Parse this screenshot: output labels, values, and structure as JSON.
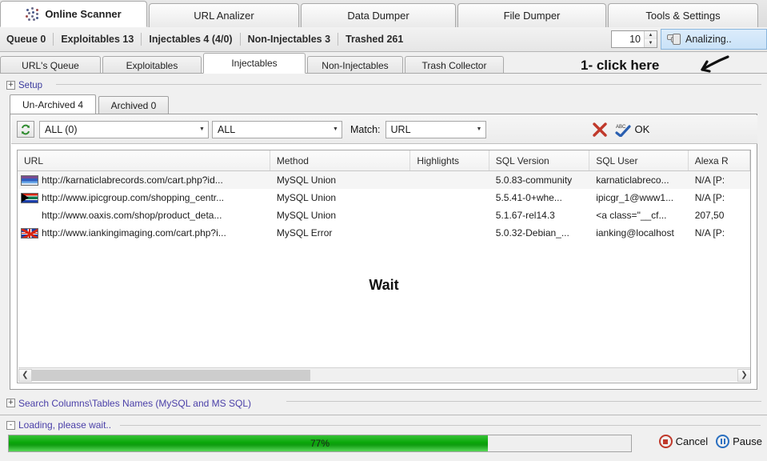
{
  "main_tabs": [
    {
      "label": "Online Scanner",
      "icon": "network-dots-icon",
      "selected": true
    },
    {
      "label": "URL Analizer",
      "selected": false
    },
    {
      "label": "Data Dumper",
      "selected": false
    },
    {
      "label": "File Dumper",
      "selected": false
    },
    {
      "label": "Tools & Settings",
      "selected": false
    }
  ],
  "counts": [
    {
      "label": "Queue 0"
    },
    {
      "label": "Exploitables 13"
    },
    {
      "label": "Injectables 4 (4/0)"
    },
    {
      "label": "Non-Injectables 3"
    },
    {
      "label": "Trashed 261"
    }
  ],
  "threads": {
    "value": "10"
  },
  "status": {
    "label": "Analizing..",
    "icon": "database-stack-icon"
  },
  "sub_tabs": [
    {
      "label": "URL's Queue",
      "selected": false
    },
    {
      "label": "Exploitables",
      "selected": false
    },
    {
      "label": "Injectables",
      "selected": true
    },
    {
      "label": "Non-Injectables",
      "selected": false
    },
    {
      "label": "Trash Collector",
      "selected": false
    }
  ],
  "annotation": {
    "text": "1- click here",
    "arrow": "hand-drawn-arrow"
  },
  "setup": {
    "label": "Setup",
    "expander": "+"
  },
  "archive_tabs": [
    {
      "label": "Un-Archived 4",
      "selected": true
    },
    {
      "label": "Archived 0",
      "selected": false
    }
  ],
  "filter_bar": {
    "refresh_icon": "refresh-icon",
    "combo_count": "ALL (0)",
    "combo_type": "ALL",
    "match_label": "Match:",
    "combo_match": "URL",
    "clear_icon": "red-x-icon",
    "spellcheck_icon": "abc-check-icon",
    "ok_label": "OK"
  },
  "table": {
    "columns": [
      "URL",
      "Method",
      "Highlights",
      "SQL Version",
      "SQL User",
      "Alexa R"
    ],
    "rows": [
      {
        "flag": "flag-tricolor",
        "url": "http://karnaticlabrecords.com/cart.php?id...",
        "method": "MySQL Union",
        "highlights": "",
        "sql_version": "5.0.83-community",
        "sql_user": "karnaticlabreco...",
        "alexa": "N/A [P:"
      },
      {
        "flag": "flag-south-africa",
        "url": "http://www.ipicgroup.com/shopping_centr...",
        "method": "MySQL Union",
        "highlights": "",
        "sql_version": "5.5.41-0+whe...",
        "sql_user": "ipicgr_1@www1...",
        "alexa": "N/A [P:"
      },
      {
        "flag": "flag-none",
        "url": "http://www.oaxis.com/shop/product_deta...",
        "method": "MySQL Union",
        "highlights": "",
        "sql_version": "5.1.67-rel14.3",
        "sql_user": "<a class=\"__cf...",
        "alexa": "207,50"
      },
      {
        "flag": "flag-united-kingdom",
        "url": "http://www.iankingimaging.com/cart.php?i...",
        "method": "MySQL Error",
        "highlights": "",
        "sql_version": "5.0.32-Debian_...",
        "sql_user": "ianking@localhost",
        "alexa": "N/A [P:"
      }
    ],
    "overlay_text": "Wait",
    "scroll_left_icon": "chevron-left-icon",
    "scroll_right_icon": "chevron-right-icon"
  },
  "search_section": {
    "label": "Search Columns\\Tables Names (MySQL and MS SQL)",
    "expander": "+"
  },
  "loading": {
    "label": "Loading, please wait..",
    "expander": "-",
    "percent_text": "77%",
    "percent_value": 77,
    "cancel_label": "Cancel",
    "cancel_icon": "stop-circle-icon",
    "pause_label": "Pause",
    "pause_icon": "pause-circle-icon"
  },
  "colors": {
    "accent": "#2a6fc0",
    "progress_green": "#0aa60a",
    "link_purple": "#4a3fa8",
    "danger_red": "#c0392b"
  }
}
